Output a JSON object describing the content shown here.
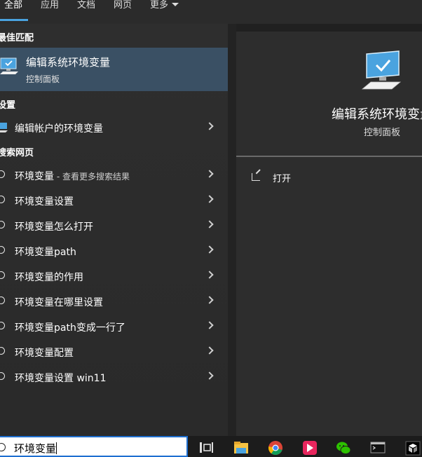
{
  "tabs": [
    {
      "label": "全部"
    },
    {
      "label": "应用"
    },
    {
      "label": "文档"
    },
    {
      "label": "网页"
    },
    {
      "label": "更多"
    }
  ],
  "sections": {
    "best_match": "最佳匹配",
    "settings": "设置",
    "web": "搜索网页"
  },
  "best_match": {
    "title": "编辑系统环境变量",
    "subtitle": "控制面板"
  },
  "settings_items": [
    {
      "label": "编辑帐户的环境变量"
    }
  ],
  "web_items": [
    {
      "label": "环境变量",
      "suffix": " - 查看更多搜索结果"
    },
    {
      "label": "环境变量设置",
      "suffix": ""
    },
    {
      "label": "环境变量怎么打开",
      "suffix": ""
    },
    {
      "label": "环境变量path",
      "suffix": ""
    },
    {
      "label": "环境变量的作用",
      "suffix": ""
    },
    {
      "label": "环境变量在哪里设置",
      "suffix": ""
    },
    {
      "label": "环境变量path变成一行了",
      "suffix": ""
    },
    {
      "label": "环境变量配置",
      "suffix": ""
    },
    {
      "label": "环境变量设置 win11",
      "suffix": ""
    }
  ],
  "detail": {
    "title": "编辑系统环境变量",
    "subtitle": "控制面板",
    "action_open": "打开"
  },
  "search": {
    "value": "环境变量"
  },
  "colors": {
    "accent": "#4aa3df",
    "selected_bg": "#3a5064"
  }
}
